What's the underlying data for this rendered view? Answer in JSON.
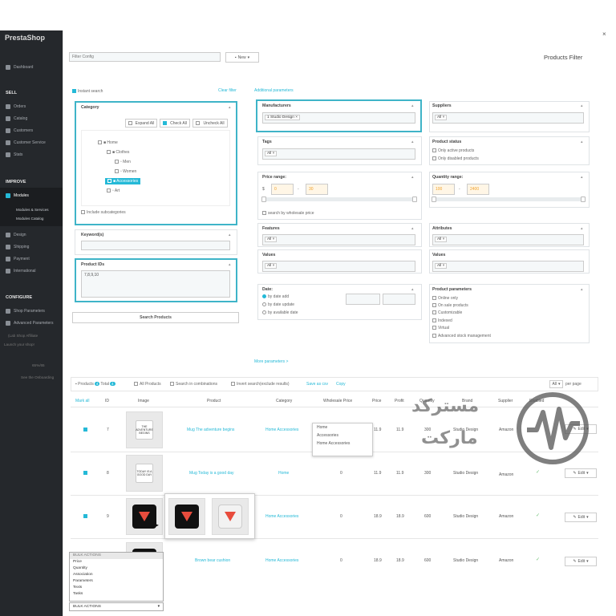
{
  "app": {
    "logo": "PrestaShop",
    "close": "×"
  },
  "sidebar": {
    "items_top": [
      {
        "label": "Dashboard",
        "icon": "trend-icon"
      }
    ],
    "sections": [
      "SELL",
      "IMPROVE",
      "CONFIGURE"
    ],
    "sell": [
      "Orders",
      "Catalog",
      "Customers",
      "Customer Service",
      "Stats"
    ],
    "improve": [
      "Modules",
      "Design",
      "Shipping",
      "Payment",
      "International"
    ],
    "modules_sub": [
      "Modules & Services",
      "Modules Catalog"
    ],
    "configure": [
      "Shop Parameters",
      "Advanced Parameters"
    ],
    "extra": [
      "(Lab Shop Affiliate",
      "Launch your shop!",
      "65%/65",
      "See the Onboarding"
    ]
  },
  "header": {
    "filter_placeholder": "Filter Config",
    "new_button": "New",
    "title": "Products Filter"
  },
  "filters": {
    "instant_search": "Instant search",
    "clear_filter": "Clear filter",
    "additional_parameters": "Additional parameters",
    "category": {
      "title": "Category",
      "expand_all": "Expand All",
      "check_all": "Check All",
      "uncheck_all": "Uncheck All",
      "tree": [
        "Home",
        "Clothes",
        "Men",
        "Women",
        "Accessories",
        "Art"
      ],
      "include_sub": "Include subcategories"
    },
    "keywords": {
      "title": "Keyword(s)"
    },
    "product_ids": {
      "title": "Product IDs",
      "value": "7,8,9,10"
    },
    "search_button": "Search Products",
    "manufacturers": {
      "title": "Manufacturers",
      "tag": "1 Studio Design"
    },
    "suppliers": {
      "title": "Suppliers",
      "tag": "All"
    },
    "tags": {
      "title": "Tags",
      "tag": "All"
    },
    "product_status": {
      "title": "Product status",
      "options": [
        "Only active products",
        "Only disabled products"
      ]
    },
    "price_range": {
      "title": "Price range:",
      "currency": "$",
      "min": "0",
      "max": "30",
      "wholesale": "search by wholesale price"
    },
    "quantity_range": {
      "title": "Quantity range:",
      "min": "100",
      "max": "2400"
    },
    "features": {
      "title": "Features",
      "tag": "All"
    },
    "attributes": {
      "title": "Attributes",
      "tag": "All"
    },
    "values_left": {
      "title": "Values",
      "tag": "All"
    },
    "values_right": {
      "title": "Values",
      "tag": "All"
    },
    "date": {
      "title": "Date:",
      "options": [
        "by date add",
        "by date update",
        "by available date"
      ]
    },
    "product_parameters": {
      "title": "Product parameters",
      "options": [
        "Online only",
        "On sale products",
        "Customizable",
        "Indexed",
        "Virtual",
        "Advanced stock management"
      ]
    },
    "more_parameters": "More parameters >"
  },
  "results": {
    "products_label": "Products",
    "products_count": "4",
    "total_label": "Total",
    "total_count": "4",
    "all_products": "All Products",
    "search_combinations": "Search in combinations",
    "invert_search": "Invert search(exclude results)",
    "save_csv": "Save as csv",
    "copy": "Copy",
    "per_page_value": "All",
    "per_page_label": "per page",
    "columns": [
      "Mark all",
      "ID",
      "Image",
      "Product",
      "Category",
      "Wholesale Price",
      "Price",
      "Profit",
      "Quantity",
      "Brand",
      "Supplier",
      "Enabled"
    ],
    "rows": [
      {
        "id": "7",
        "product": "Mug The adventure begins",
        "category": "Home Accessories",
        "wholesale": "0",
        "price": "11.9",
        "profit": "11.9",
        "qty": "300",
        "brand": "Studio Design",
        "supplier": "Amazon",
        "mug_text": "THE ADVENTURE BEGINS"
      },
      {
        "id": "8",
        "product": "Mug Today is a good day",
        "category": "Home",
        "wholesale": "0",
        "price": "11.9",
        "profit": "11.9",
        "qty": "300",
        "brand": "Studio Design",
        "supplier": "Amazon",
        "mug_text": "TODAY IS A GOOD DAY"
      },
      {
        "id": "9",
        "product": "",
        "category": "Home Accessories",
        "wholesale": "0",
        "price": "18.9",
        "profit": "18.9",
        "qty": "600",
        "brand": "Studio Design",
        "supplier": "Amazon"
      },
      {
        "id": "10",
        "product": "Brown bear cushion",
        "category": "Home Accessories",
        "wholesale": "0",
        "price": "18.9",
        "profit": "18.9",
        "qty": "600",
        "brand": "Studio Design",
        "supplier": "Amazon"
      }
    ],
    "edit_label": "Edit",
    "category_dropdown": [
      "Home",
      "Accessories",
      "Home Accessories"
    ]
  },
  "bulk": {
    "options": [
      "BULK ACTIONS",
      "Price",
      "Quantity",
      "Association",
      "Parameters",
      "Texts",
      "Tasks"
    ],
    "selected": "BULK ACTIONS"
  },
  "watermark": {
    "line1": "مسترکد",
    "line2": "مارکت"
  },
  "colors": {
    "accent": "#25b9d7",
    "highlight_border": "#3fb4c8",
    "sidebar": "#25282c",
    "enabled": "#72c279"
  }
}
